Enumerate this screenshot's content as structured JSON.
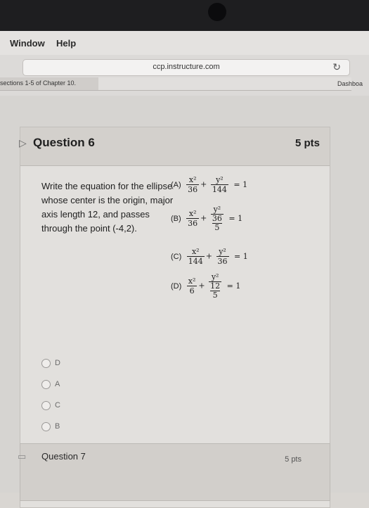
{
  "menubar": {
    "items": [
      "Window",
      "Help"
    ]
  },
  "browser": {
    "url": "ccp.instructure.com",
    "tab_left": "sections 1-5 of Chapter 10.",
    "tab_right": "Dashboa"
  },
  "question6": {
    "title": "Question 6",
    "points": "5 pts",
    "prompt": "Write the equation for the ellipse whose center is the origin, major axis length 12, and passes through the point (-4,2).",
    "options": {
      "A": {
        "label": "(A)",
        "x2": "x²",
        "d1": "36",
        "y2": "y²",
        "d2": "144",
        "rhs": "= 1"
      },
      "B": {
        "label": "(B)",
        "x2": "x²",
        "d1": "36",
        "y2": "y²",
        "d2n": "36",
        "d2d": "5",
        "rhs": "= 1"
      },
      "C": {
        "label": "(C)",
        "x2": "x²",
        "d1": "144",
        "y2": "y²",
        "d2": "36",
        "rhs": "= 1"
      },
      "D": {
        "label": "(D)",
        "x2": "x²",
        "d1": "6",
        "y2": "y²",
        "d2n": "12",
        "d2d": "5",
        "rhs": "= 1"
      }
    },
    "answers": [
      "D",
      "A",
      "C",
      "B"
    ]
  },
  "question7": {
    "title": "Question 7",
    "points": "5 pts"
  }
}
